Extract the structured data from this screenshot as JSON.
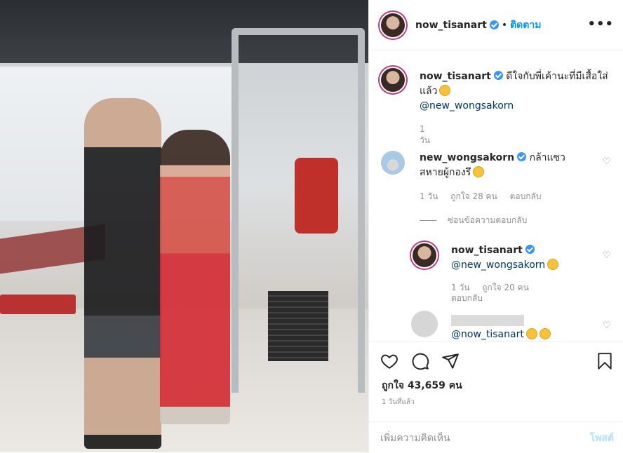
{
  "header": {
    "username": "now_tisanart",
    "separator": "•",
    "follow_label": "ติดตาม",
    "more_label": "•••"
  },
  "caption": {
    "username": "now_tisanart",
    "text": "ดีใจกับพี่เค้านะที่มีเสื้อใส่แล้ว",
    "mention": "@new_wongsakorn",
    "time": "1 วัน"
  },
  "comments": [
    {
      "username": "new_wongsakorn",
      "text": "กล้าแซวสหายผู้กองรึ",
      "time": "1 วัน",
      "likes": "ถูกใจ 28 คน",
      "reply": "ตอบกลับ"
    }
  ],
  "hide_replies_label": "ซ่อนข้อความตอบกลับ",
  "replies": [
    {
      "username": "now_tisanart",
      "mention": "@new_wongsakorn",
      "time": "1 วัน",
      "likes": "ถูกใจ 20 คน",
      "reply": "ตอบกลับ"
    },
    {
      "mention": "@now_tisanart"
    }
  ],
  "footer": {
    "likes": "ถูกใจ 43,659 คน",
    "time": "1 วันที่แล้ว",
    "comment_placeholder": "เพิ่มความคิดเห็น",
    "post_label": "โพสต์"
  },
  "colors": {
    "link": "#0095f6",
    "verified": "#3897f0",
    "meta": "#8e8e8e",
    "post_disabled": "#b2dffc"
  }
}
